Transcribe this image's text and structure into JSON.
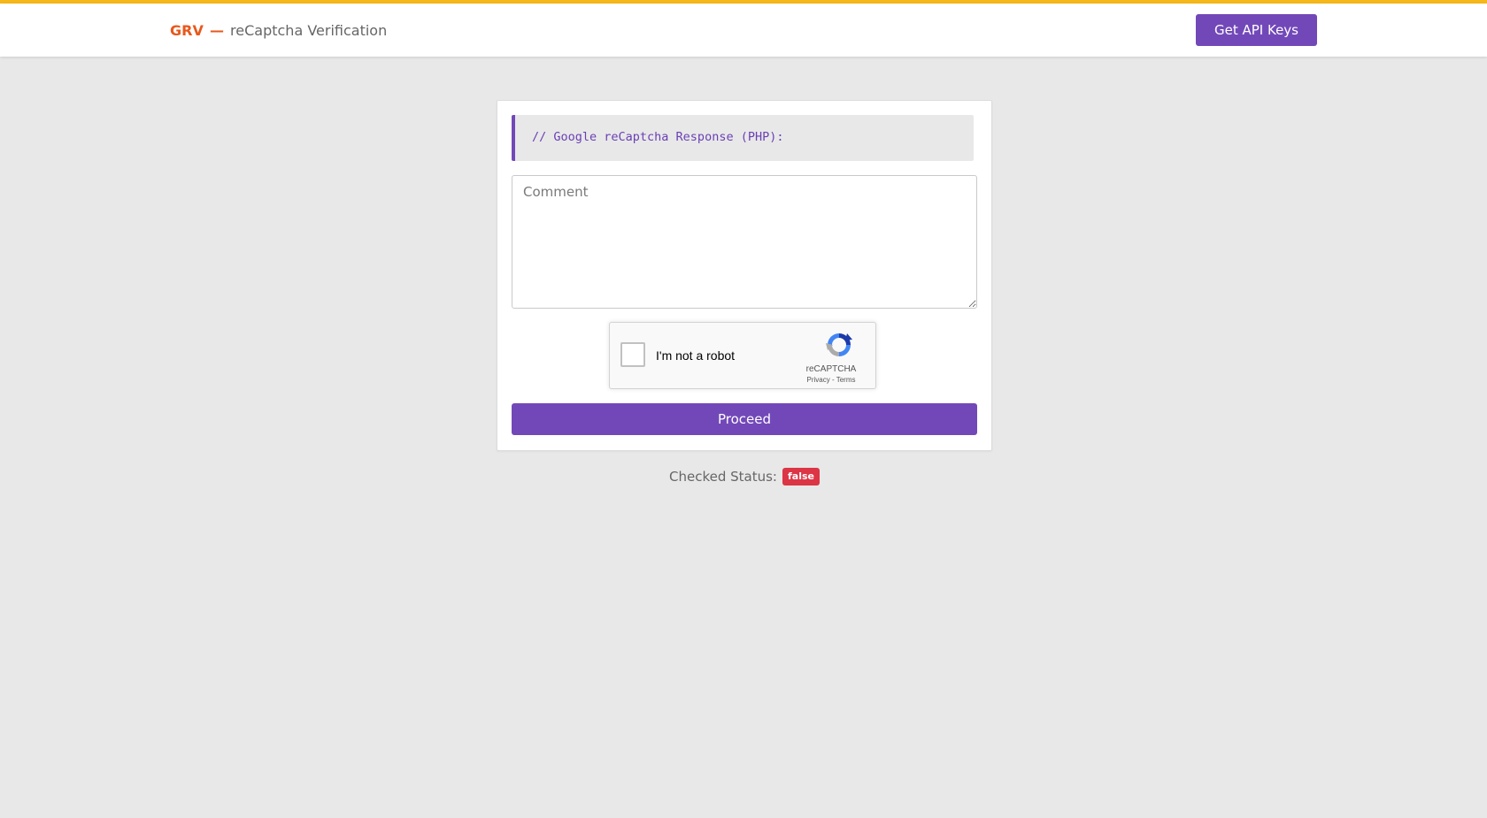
{
  "header": {
    "brand_name": "GRV",
    "brand_dash": "—",
    "brand_subtitle": "reCaptcha Verification",
    "api_button_label": "Get API Keys",
    "accent_color": "#7248b9",
    "brand_color": "#e8581c",
    "top_bar_color": "#f6b818"
  },
  "form": {
    "code_comment": "// Google reCaptcha Response (PHP):",
    "comment_placeholder": "Comment",
    "comment_value": "",
    "proceed_label": "Proceed"
  },
  "recaptcha": {
    "label": "I'm not a robot",
    "brand": "reCAPTCHA",
    "privacy": "Privacy",
    "separator": " - ",
    "terms": "Terms",
    "checked": false
  },
  "status": {
    "label": "Checked Status:",
    "value": "false",
    "badge_color": "#dc3545"
  }
}
